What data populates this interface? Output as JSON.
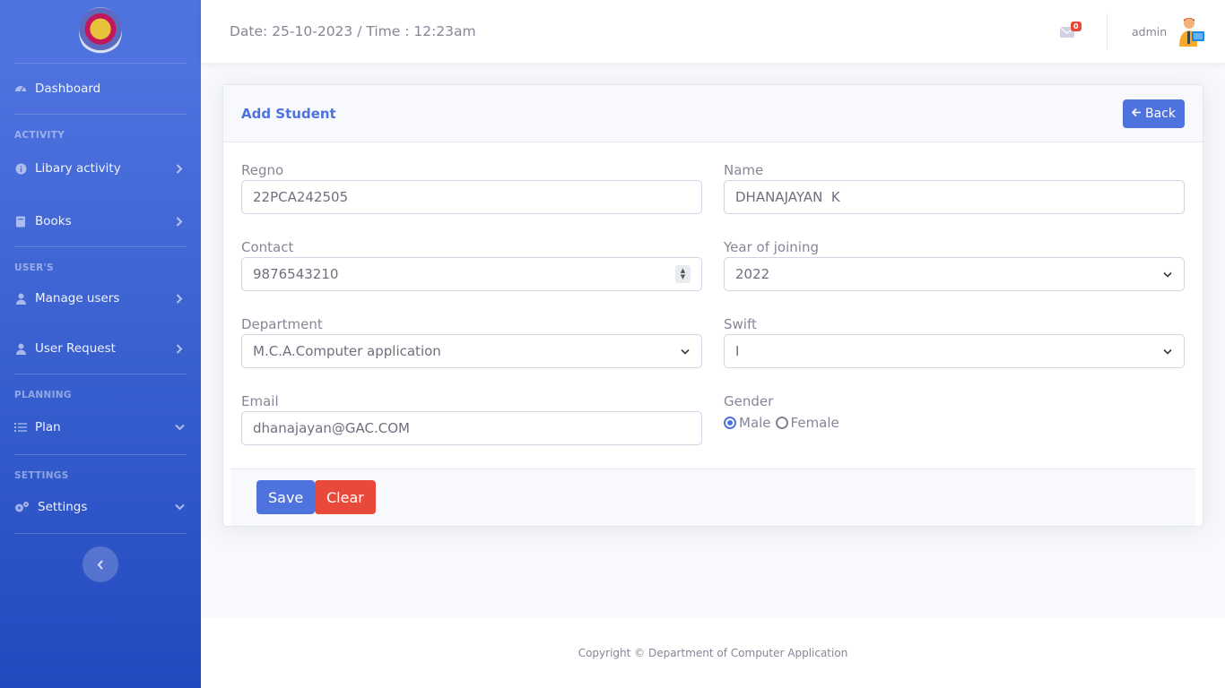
{
  "sidebar": {
    "items": {
      "dashboard": "Dashboard",
      "library_activity": "Libary activity",
      "books": "Books",
      "manage_users": "Manage users",
      "user_request": "User Request",
      "plan": "Plan",
      "settings": "Settings"
    },
    "headings": {
      "activity": "ACTIVITY",
      "users": "USER'S",
      "planning": "PLANNING",
      "settings": "SETTINGS"
    }
  },
  "topbar": {
    "datetime": "Date: 25-10-2023 / Time : 12:23am",
    "mail_count": "0",
    "username": "admin"
  },
  "form": {
    "title": "Add Student",
    "back_label": "Back",
    "regno": {
      "label": "Regno",
      "value": "22PCA242505"
    },
    "name": {
      "label": "Name",
      "value": "DHANAJAYAN  K"
    },
    "contact": {
      "label": "Contact",
      "value": "9876543210"
    },
    "year": {
      "label": "Year of joining",
      "value": "2022"
    },
    "department": {
      "label": "Department",
      "value": "M.C.A.Computer application"
    },
    "swift": {
      "label": "Swift",
      "value": "I"
    },
    "email": {
      "label": "Email",
      "value": "dhanajayan@GAC.COM"
    },
    "gender": {
      "label": "Gender",
      "options": [
        "Male",
        "Female"
      ],
      "selected": "Male"
    },
    "save_label": "Save",
    "clear_label": "Clear"
  },
  "footer": {
    "copyright": "Copyright © Department of Computer Application"
  },
  "colors": {
    "primary": "#4e73df",
    "danger": "#e74a3b",
    "text_muted": "#858796"
  }
}
